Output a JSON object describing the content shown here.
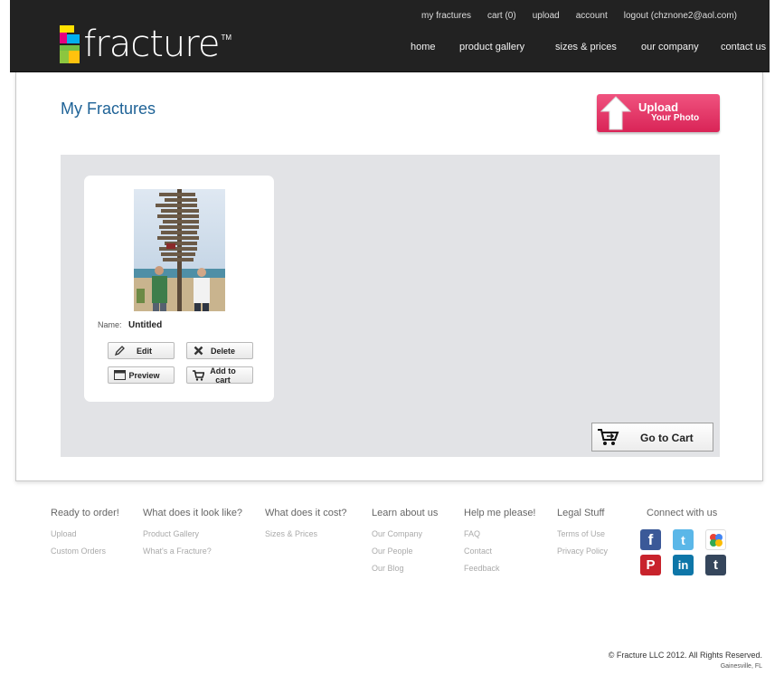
{
  "header": {
    "logo_text": "fracture",
    "logo_tm": "TM",
    "top_links": [
      "my fractures",
      "cart (0)",
      "upload",
      "account",
      "logout (chznone2@aol.com)"
    ],
    "nav": [
      "home",
      "product gallery",
      "sizes & prices",
      "our company",
      "contact us"
    ]
  },
  "main": {
    "title": "My Fractures",
    "upload_button": {
      "line1": "Upload",
      "line2": "Your Photo"
    },
    "card": {
      "name_label": "Name:",
      "name_value": "Untitled",
      "buttons": {
        "edit": "Edit",
        "delete": "Delete",
        "preview": "Preview",
        "add_to_cart": "Add to cart"
      }
    },
    "go_to_cart": "Go to Cart"
  },
  "footer": {
    "columns": [
      {
        "heading": "Ready to order!",
        "links": [
          "Upload",
          "Custom Orders"
        ]
      },
      {
        "heading": "What does it look like?",
        "links": [
          "Product Gallery",
          "What's a Fracture?"
        ]
      },
      {
        "heading": "What does it cost?",
        "links": [
          "Sizes & Prices"
        ]
      },
      {
        "heading": "Learn about us",
        "links": [
          "Our Company",
          "Our People",
          "Our Blog"
        ]
      },
      {
        "heading": "Help me please!",
        "links": [
          "FAQ",
          "Contact",
          "Feedback"
        ]
      },
      {
        "heading": "Legal Stuff",
        "links": [
          "Terms of Use",
          "Privacy Policy"
        ]
      },
      {
        "heading": "Connect with us",
        "links": []
      }
    ],
    "social_icons": [
      "facebook-icon",
      "twitter-icon",
      "google-icon",
      "pinterest-icon",
      "linkedin-icon",
      "tumblr-icon"
    ],
    "copyright": "© Fracture LLC 2012. All Rights Reserved.",
    "location": "Gainesville, FL"
  },
  "colors": {
    "header_bg": "#222222",
    "title_blue": "#1f6397",
    "upload_pink": "#e0355f",
    "gallery_bg": "#e2e3e6"
  }
}
